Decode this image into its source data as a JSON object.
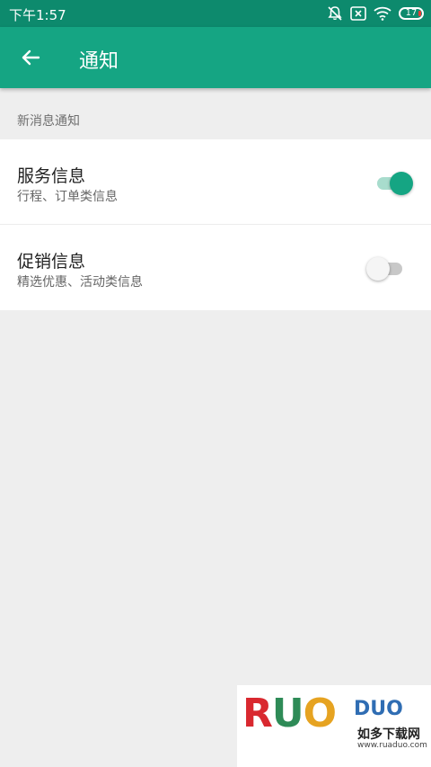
{
  "status_bar": {
    "time": "下午1:57",
    "battery": "17",
    "icons": [
      "silent-icon",
      "sim-x-icon",
      "wifi-icon",
      "battery-icon"
    ]
  },
  "app_bar": {
    "title": "通知",
    "back_icon": "arrow-left-icon"
  },
  "section": {
    "header": "新消息通知"
  },
  "settings": [
    {
      "title": "服务信息",
      "subtitle": "行程、订单类信息",
      "enabled": true
    },
    {
      "title": "促销信息",
      "subtitle": "精选优惠、活动类信息",
      "enabled": false
    }
  ],
  "watermark": {
    "logo": "RUAODUO",
    "brand_cn": "如多下载网",
    "url": "www.ruaduo.com"
  },
  "colors": {
    "status_bar": "#0d8a6d",
    "app_bar": "#15a583",
    "accent": "#15a583",
    "background": "#eeeeee"
  }
}
